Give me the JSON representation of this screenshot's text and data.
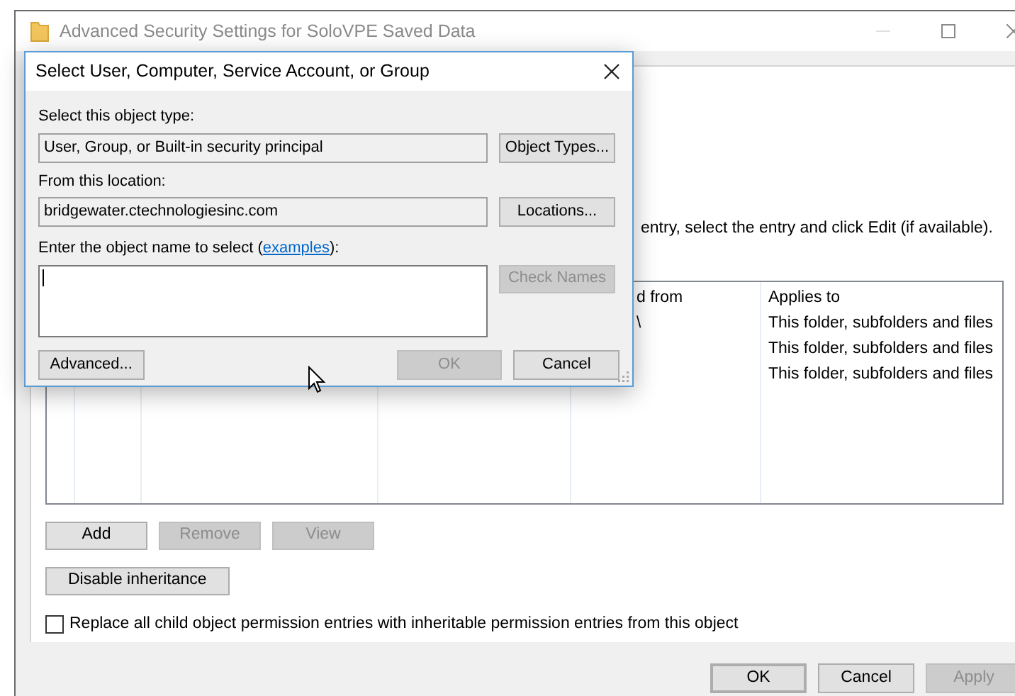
{
  "window": {
    "title": "Advanced Security Settings for SoloVPE Saved Data"
  },
  "instructions": "entry, select the entry and click Edit (if available).",
  "permission_table": {
    "columns": [
      "d from",
      "Applies to"
    ],
    "rows": [
      {
        "column_1": "\\",
        "applies_to": "This folder, subfolders and files"
      },
      {
        "column_1": "",
        "applies_to": "This folder, subfolders and files"
      },
      {
        "column_1": "",
        "applies_to": "This folder, subfolders and files"
      }
    ]
  },
  "entry_buttons": [
    {
      "label": "Add",
      "disabled": false
    },
    {
      "label": "Remove",
      "disabled": true
    },
    {
      "label": "View",
      "disabled": true
    }
  ],
  "disable_inheritance_button": "Disable inheritance",
  "replace_checkbox": {
    "label": "Replace all child object permission entries with inheritable permission entries from this object",
    "checked": false
  },
  "footer_buttons": [
    {
      "label": "OK",
      "disabled": false,
      "default": true
    },
    {
      "label": "Cancel",
      "disabled": false,
      "default": false
    },
    {
      "label": "Apply",
      "disabled": true,
      "default": false
    }
  ],
  "dialog": {
    "title": "Select User, Computer, Service Account, or Group",
    "object_type_label": "Select this object type:",
    "object_type_value": "User, Group, or Built-in security principal",
    "object_types_button": "Object Types...",
    "location_label": "From this location:",
    "location_value": "bridgewater.ctechnologiesinc.com",
    "locations_button": "Locations...",
    "name_prompt": {
      "before": "Enter the object name to select (",
      "link": "examples",
      "after": "):"
    },
    "check_names_button": {
      "label": "Check Names",
      "disabled": true
    },
    "buttons": [
      {
        "label": "Advanced...",
        "disabled": false
      },
      {
        "label": "OK",
        "disabled": true
      },
      {
        "label": "Cancel",
        "disabled": false
      }
    ]
  }
}
